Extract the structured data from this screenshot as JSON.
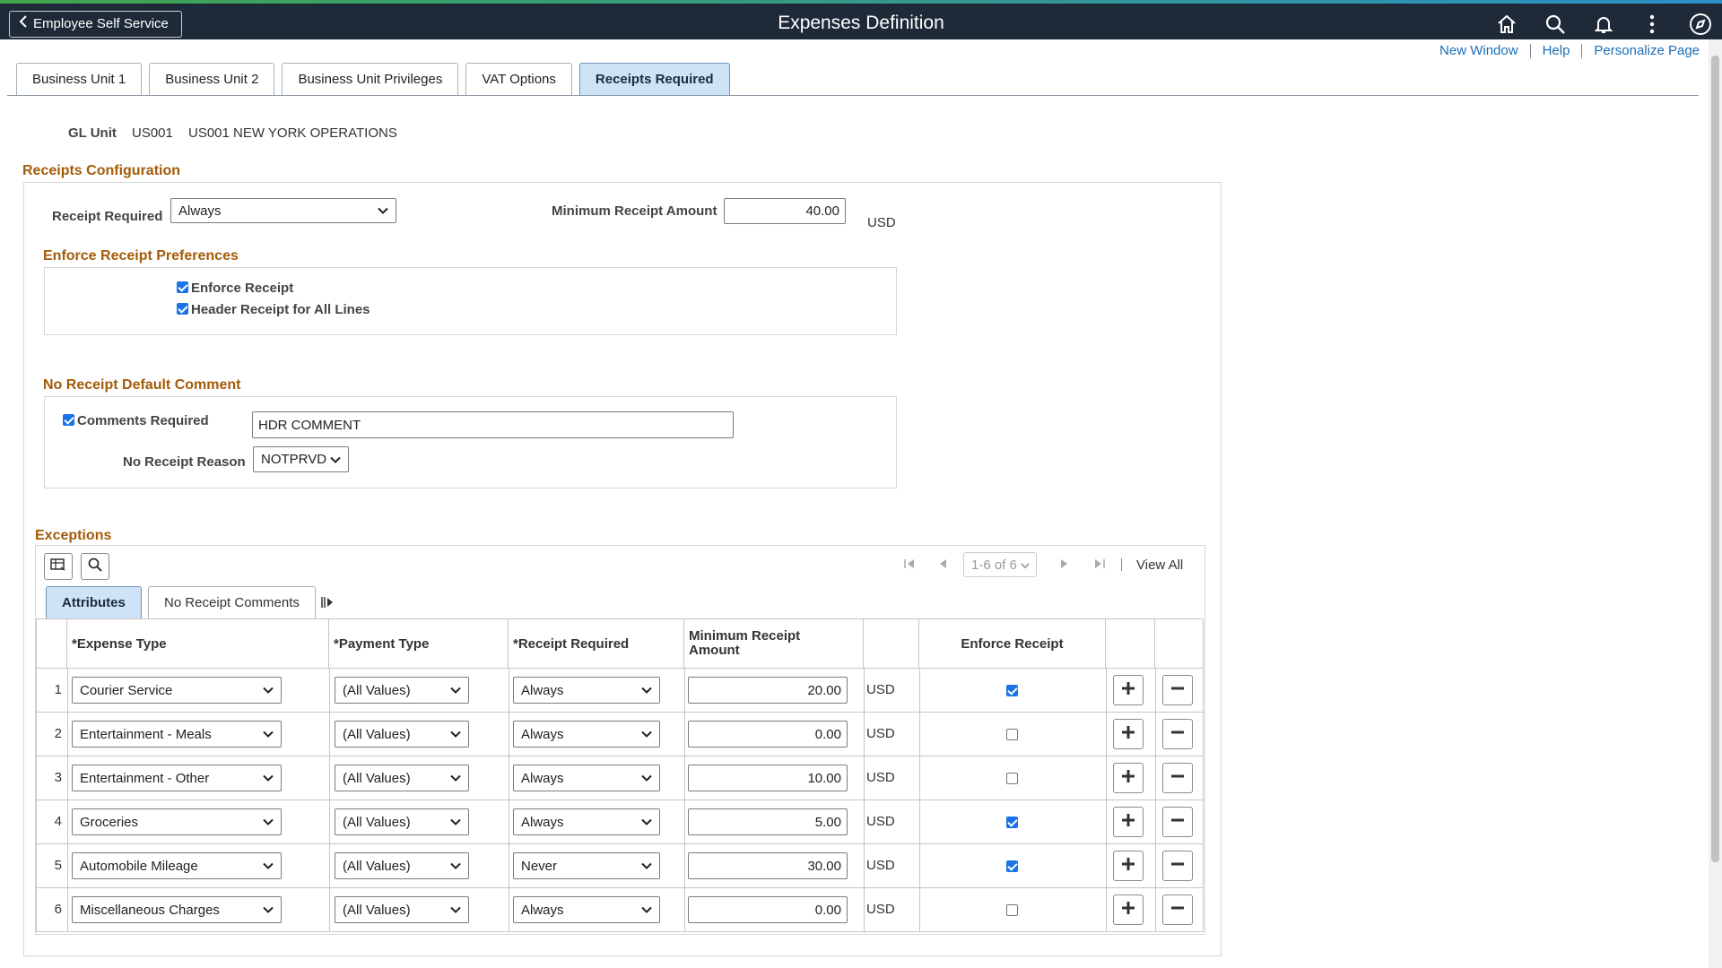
{
  "header": {
    "back_label": "Employee Self Service",
    "title": "Expenses Definition",
    "icons": [
      "home-icon",
      "search-icon",
      "bell-icon",
      "more-icon",
      "navbar-icon"
    ]
  },
  "links": {
    "new_window": "New Window",
    "help": "Help",
    "personalize": "Personalize Page"
  },
  "tabs": [
    {
      "label": "Business Unit 1",
      "active": false
    },
    {
      "label": "Business Unit 2",
      "active": false
    },
    {
      "label": "Business Unit Privileges",
      "active": false
    },
    {
      "label": "VAT Options",
      "active": false
    },
    {
      "label": "Receipts Required",
      "active": true
    }
  ],
  "gl": {
    "label": "GL Unit",
    "code": "US001",
    "name": "US001 NEW YORK OPERATIONS"
  },
  "receipts_config": {
    "title": "Receipts Configuration",
    "receipt_required_label": "Receipt Required",
    "receipt_required_value": "Always",
    "min_amount_label": "Minimum Receipt Amount",
    "min_amount_value": "40.00",
    "currency": "USD"
  },
  "enforce": {
    "title": "Enforce Receipt Preferences",
    "enforce_receipt_label": "Enforce Receipt",
    "enforce_receipt_checked": true,
    "header_receipt_label": "Header Receipt for All Lines",
    "header_receipt_checked": true
  },
  "no_receipt": {
    "title": "No Receipt Default Comment",
    "comments_required_label": "Comments Required",
    "comments_required_checked": true,
    "comment_value": "HDR COMMENT",
    "reason_label": "No Receipt Reason",
    "reason_value": "NOTPRVD"
  },
  "exceptions": {
    "title": "Exceptions",
    "pager_text": "1-6 of 6",
    "view_all": "View All",
    "subtabs": [
      {
        "label": "Attributes",
        "active": true
      },
      {
        "label": "No Receipt Comments",
        "active": false
      }
    ],
    "columns": {
      "expense_type": "*Expense Type",
      "payment_type": "*Payment Type",
      "receipt_required": "*Receipt Required",
      "min_amount_1": "Minimum Receipt",
      "min_amount_2": "Amount",
      "enforce_receipt": "Enforce Receipt"
    },
    "rows": [
      {
        "num": "1",
        "expense_type": "Courier Service",
        "payment_type": "(All Values)",
        "receipt_required": "Always",
        "amount": "20.00",
        "currency": "USD",
        "enforce": true
      },
      {
        "num": "2",
        "expense_type": "Entertainment - Meals",
        "payment_type": "(All Values)",
        "receipt_required": "Always",
        "amount": "0.00",
        "currency": "USD",
        "enforce": false
      },
      {
        "num": "3",
        "expense_type": "Entertainment - Other",
        "payment_type": "(All Values)",
        "receipt_required": "Always",
        "amount": "10.00",
        "currency": "USD",
        "enforce": false
      },
      {
        "num": "4",
        "expense_type": "Groceries",
        "payment_type": "(All Values)",
        "receipt_required": "Always",
        "amount": "5.00",
        "currency": "USD",
        "enforce": true
      },
      {
        "num": "5",
        "expense_type": "Automobile Mileage",
        "payment_type": "(All Values)",
        "receipt_required": "Never",
        "amount": "30.00",
        "currency": "USD",
        "enforce": true
      },
      {
        "num": "6",
        "expense_type": "Miscellaneous Charges",
        "payment_type": "(All Values)",
        "receipt_required": "Always",
        "amount": "0.00",
        "currency": "USD",
        "enforce": false
      }
    ]
  }
}
